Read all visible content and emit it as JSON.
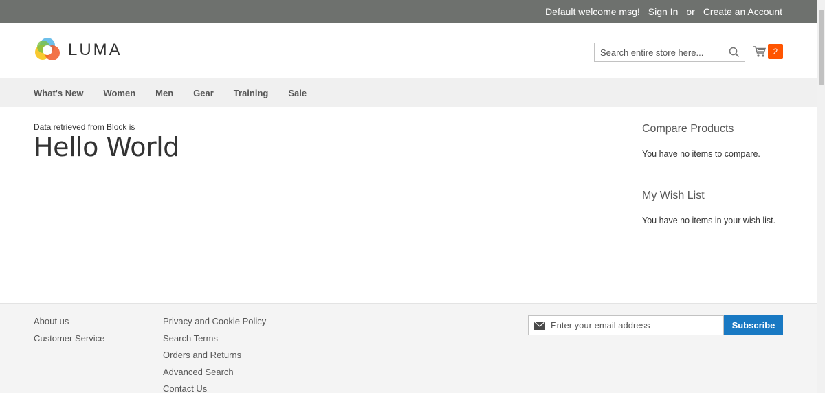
{
  "top_bar": {
    "welcome": "Default welcome msg!",
    "sign_in": "Sign In",
    "or": "or",
    "create_account": "Create an Account"
  },
  "header": {
    "logo_text": "LUMA",
    "search_placeholder": "Search entire store here...",
    "cart_count": "2"
  },
  "nav": {
    "items": [
      "What's New",
      "Women",
      "Men",
      "Gear",
      "Training",
      "Sale"
    ]
  },
  "main": {
    "label": "Data retrieved from Block is",
    "title": "Hello World"
  },
  "sidebar": {
    "compare": {
      "title": "Compare Products",
      "text": "You have no items to compare."
    },
    "wishlist": {
      "title": "My Wish List",
      "text": "You have no items in your wish list."
    }
  },
  "footer": {
    "col1": [
      "About us",
      "Customer Service"
    ],
    "col2": [
      "Privacy and Cookie Policy",
      "Search Terms",
      "Orders and Returns",
      "Advanced Search",
      "Contact Us"
    ],
    "newsletter_placeholder": "Enter your email address",
    "subscribe_label": "Subscribe"
  },
  "colors": {
    "top_bar": "#6e716e",
    "accent": "#1979c3",
    "cart_badge": "#ff5501"
  },
  "icons": {
    "search": "search-icon",
    "cart": "cart-icon",
    "email": "envelope-icon",
    "logo": "luma-logo-icon"
  }
}
